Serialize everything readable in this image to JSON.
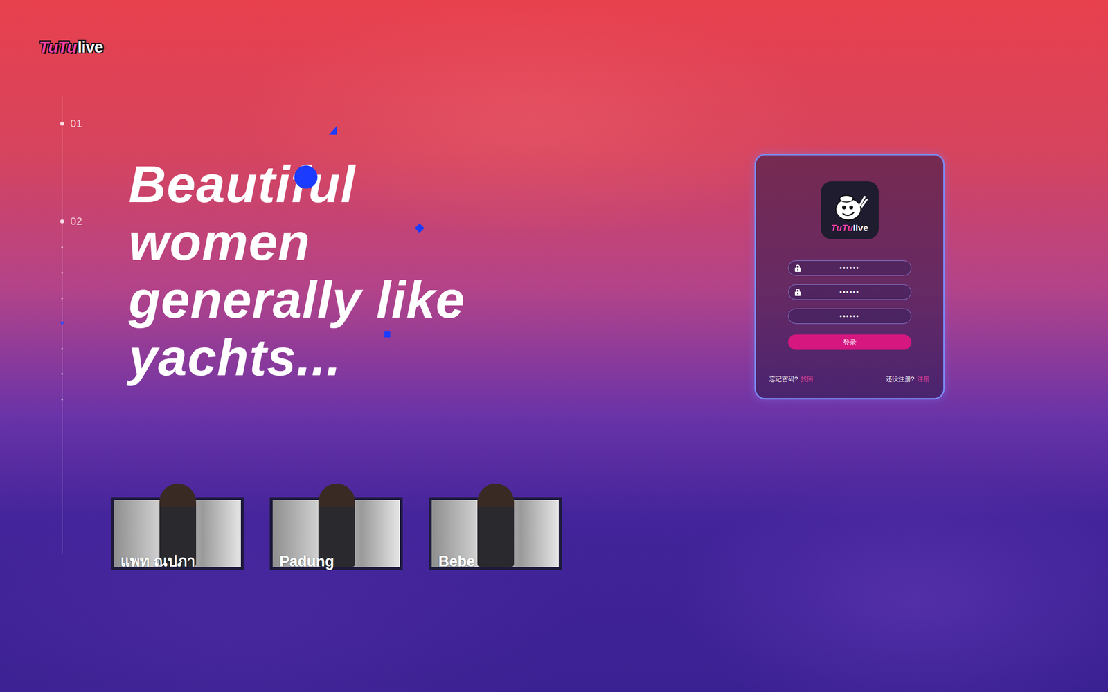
{
  "logo": {
    "brand": "TuTu",
    "suffix": "live"
  },
  "slide_markers": [
    {
      "label": "01"
    },
    {
      "label": "02"
    }
  ],
  "headline": {
    "lines": [
      "Beautiful",
      "women",
      "generally like",
      "yachts..."
    ]
  },
  "featured": [
    {
      "name": "แพท ณปภา"
    },
    {
      "name": "Padung"
    },
    {
      "name": "Bebe"
    }
  ],
  "login": {
    "app_icon": {
      "brand": "TuTu",
      "suffix": "live"
    },
    "fields": [
      {
        "value": "••••••",
        "kind": "lock"
      },
      {
        "value": "••••••",
        "kind": "lock"
      },
      {
        "value": "••••••",
        "kind": "plain"
      }
    ],
    "submit": "登录",
    "forgot": {
      "prompt": "忘记密码?",
      "link": "找回"
    },
    "register": {
      "prompt": "还没注册?",
      "link": "注册"
    }
  }
}
